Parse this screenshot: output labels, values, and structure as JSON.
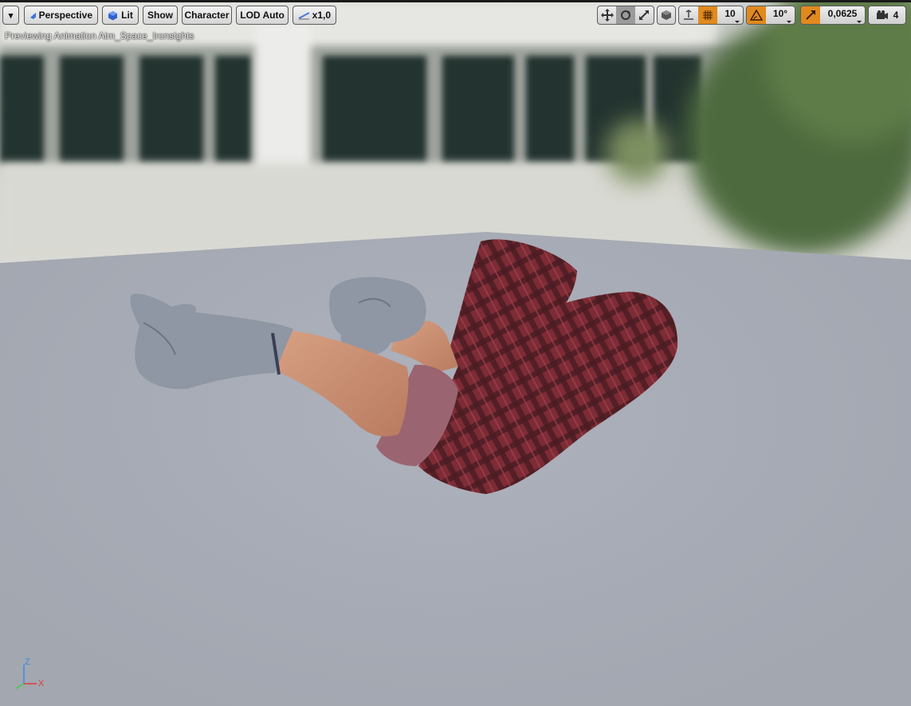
{
  "toolbar": {
    "menu_button": "▾",
    "perspective": "Perspective",
    "lit": "Lit",
    "show": "Show",
    "character": "Character",
    "lod": "LOD Auto",
    "play_speed": "x1,0",
    "grid_snap_value": "10",
    "rotation_snap_value": "10°",
    "scale_snap_value": "0,0625",
    "camera_speed": "4"
  },
  "status_text": "Previewing Animation Aim_Space_Ironsights",
  "axis_labels": {
    "z": "Z",
    "x": "X"
  },
  "colors": {
    "accent_orange": "#e08a1e",
    "axis_x": "#e23a3a",
    "axis_y": "#3ad13a",
    "axis_z": "#3a8ae2",
    "shirt_plaid": "#7d2b35",
    "glove": "#8e97a3",
    "skin": "#c98f72"
  },
  "icons": {
    "lit": "lit-sphere-icon",
    "play_speed": "play-speed-icon",
    "translate": "translate-icon",
    "rotate": "rotate-icon",
    "scale": "scale-icon",
    "world_local": "world-local-icon",
    "surface_snap": "surface-snap-icon",
    "grid_snap": "grid-snap-icon",
    "rotation_snap": "rotation-snap-icon",
    "scale_snap": "scale-snap-icon",
    "camera_speed": "camera-speed-icon"
  }
}
